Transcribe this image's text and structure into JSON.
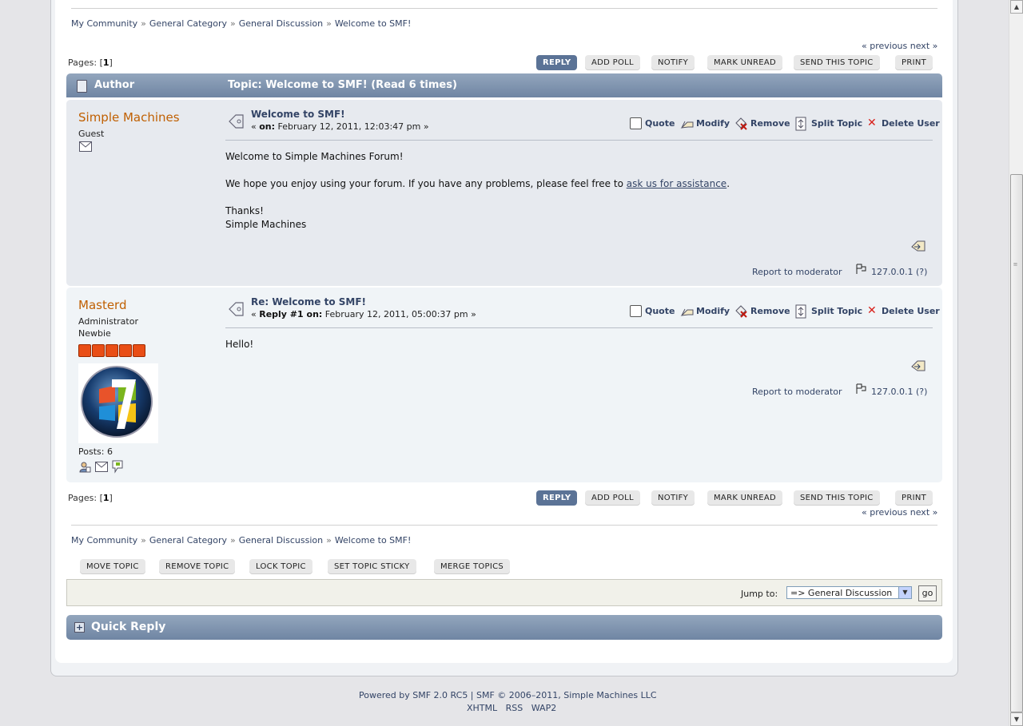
{
  "linktree": [
    "My Community",
    "General Category",
    "General Discussion",
    "Welcome to SMF!"
  ],
  "linktree_sep": "»",
  "pagination": {
    "label": "Pages:",
    "open": "[",
    "current": "1",
    "close": "]",
    "previous": "« previous",
    "next": "next »"
  },
  "buttons": {
    "reply": "REPLY",
    "add_poll": "ADD POLL",
    "notify": "NOTIFY",
    "mark_unread": "MARK UNREAD",
    "send_topic": "SEND THIS TOPIC",
    "print": "PRINT"
  },
  "header": {
    "author": "Author",
    "topic": "Topic: Welcome to SMF!  (Read 6 times)"
  },
  "post_actions": {
    "quote": "Quote",
    "modify": "Modify",
    "remove": "Remove",
    "split": "Split Topic",
    "delete_user": "Delete User"
  },
  "posts": [
    {
      "poster": "Simple Machines",
      "group": "Guest",
      "subject": "Welcome to SMF!",
      "date_prefix": "« ",
      "date_label": "on:",
      "date": " February 12, 2011, 12:03:47 pm »",
      "body": {
        "line1": "Welcome to Simple Machines Forum!",
        "line2_pre": "We hope you enjoy using your forum.  If you have any problems, please feel free to ",
        "line2_link": "ask us for assistance",
        "line2_post": ".",
        "line3": "Thanks!",
        "line4": "Simple Machines"
      },
      "report": "Report to moderator",
      "ip": "127.0.0.1 (?)"
    },
    {
      "poster": "Masterd",
      "group": "Administrator",
      "post_group": "Newbie",
      "stars": 5,
      "posts": "Posts: 6",
      "subject": "Re: Welcome to SMF!",
      "date_prefix": "« ",
      "date_label": "Reply #1 on:",
      "date": " February 12, 2011, 05:00:37 pm »",
      "body": {
        "line1": "Hello!"
      },
      "report": "Report to moderator",
      "ip": "127.0.0.1 (?)"
    }
  ],
  "mod_buttons": {
    "move": "MOVE TOPIC",
    "remove": "REMOVE TOPIC",
    "lock": "LOCK TOPIC",
    "sticky": "SET TOPIC STICKY",
    "merge": "MERGE TOPICS"
  },
  "jump": {
    "label": "Jump to:",
    "selected": "=> General Discussion",
    "go": "go"
  },
  "quick_reply": {
    "title": "Quick Reply"
  },
  "footer": {
    "powered": "Powered by SMF 2.0 RC5 | SMF © 2006–2011, Simple Machines LLC",
    "links": [
      "XHTML",
      "RSS",
      "WAP2"
    ]
  },
  "colors": {
    "accent": "#5b7396",
    "poster_name": "#c06002",
    "link": "#334466",
    "star": "#e94e16"
  }
}
